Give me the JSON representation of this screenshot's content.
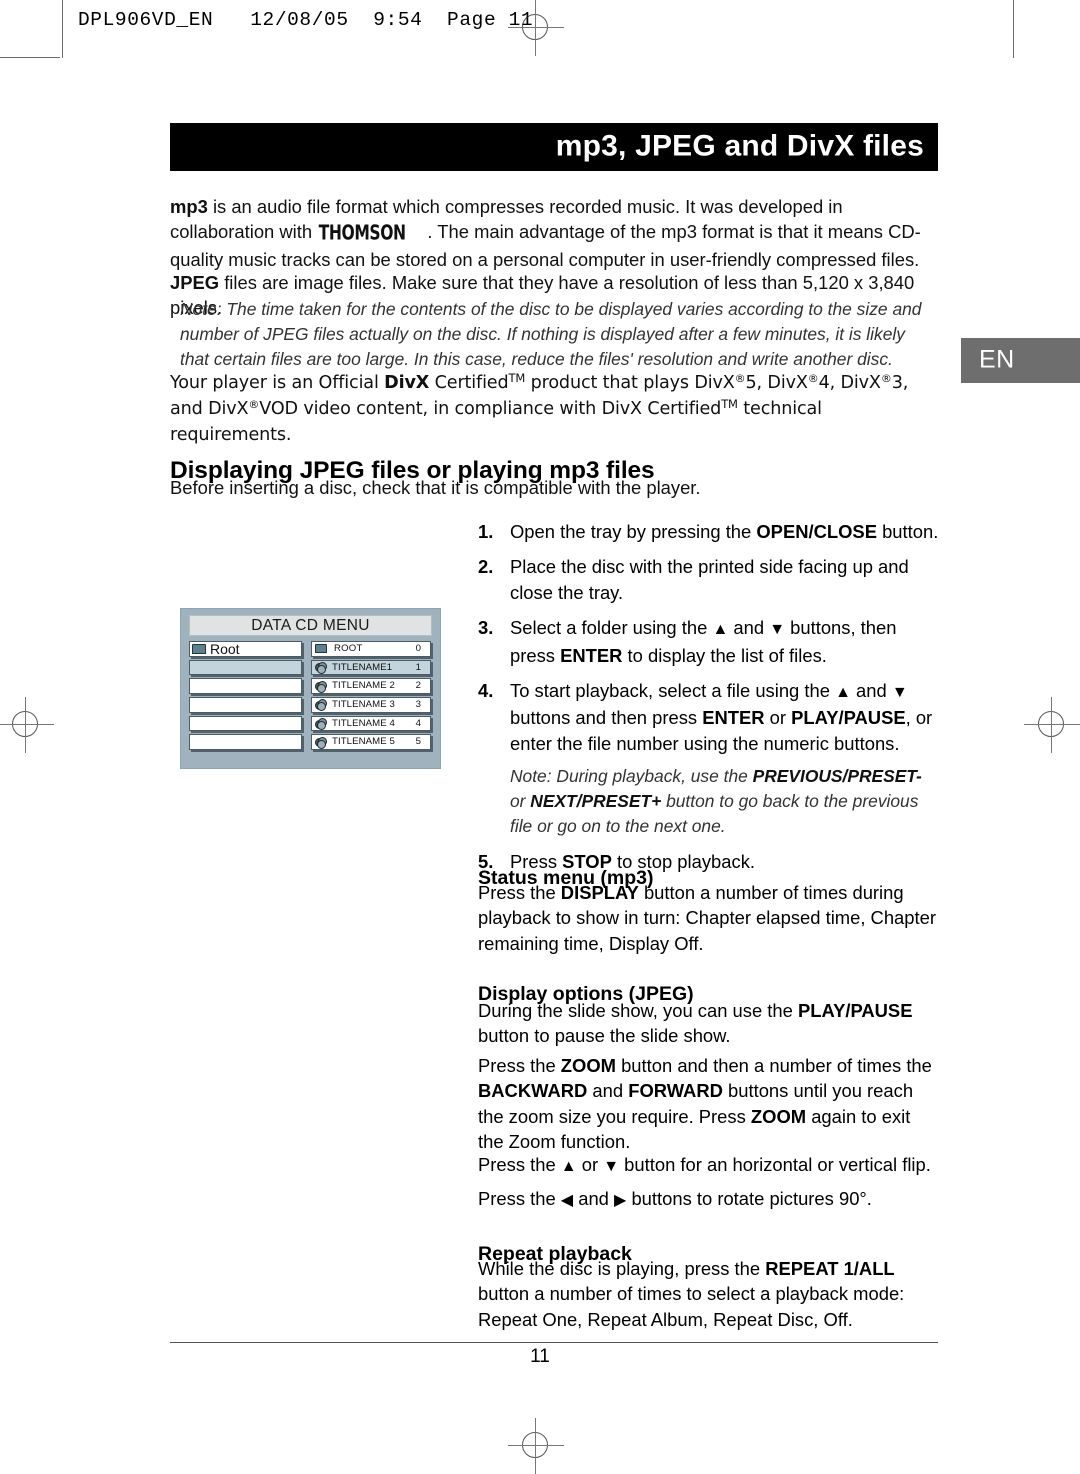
{
  "slug": "DPL906VD_EN   12/08/05  9:54  Page 11",
  "banner": {
    "title": "mp3, JPEG and DivX files"
  },
  "lang_tab": {
    "label": "EN"
  },
  "intro": {
    "mp3_lead": "mp3",
    "mp3_part1": " is an audio file format which compresses recorded music. It was developed in collaboration with ",
    "thomson_logo": "THOMSON",
    "mp3_part2": ". The main advantage of the mp3 format is that it means CD-quality music tracks can be stored on a personal computer in user-friendly compressed files.",
    "jpeg_lead": "JPEG",
    "jpeg_text": " files are image files. Make sure that they have a resolution of less than 5,120 x 3,840 pixels.",
    "note": "Note: The time taken for the contents of the disc to be displayed varies according to the size and number of JPEG files actually on the disc. If nothing is displayed after a few minutes, it is likely that certain files are too large. In this case, reduce the files' resolution and write another disc.",
    "divx_p1": "Your player is an Official ",
    "divx_bold": "DivX",
    "divx_p2": " Certified",
    "divx_tm": "TM",
    "divx_p3": " product that plays DivX",
    "divx_reg": "R",
    "divx_5": "5, DivX",
    "divx_4": "4, DivX",
    "divx_3": "3, and",
    "divx_line2_a": "DivX",
    "divx_line2_b": "VOD video content, in compliance with DivX Certified",
    "divx_line2_c": " technical requirements."
  },
  "section": {
    "heading": "Displaying JPEG files or playing mp3 files",
    "intro": "Before inserting a disc, check that it is compatible with the player."
  },
  "figure": {
    "title": "DATA CD MENU",
    "left_rows": [
      {
        "label": "Root",
        "icon": "folder-icon",
        "selected": false
      },
      {
        "label": "",
        "icon": "",
        "selected": true
      },
      {
        "label": "",
        "icon": "",
        "selected": false
      },
      {
        "label": "",
        "icon": "",
        "selected": false
      },
      {
        "label": "",
        "icon": "",
        "selected": false
      },
      {
        "label": "",
        "icon": "",
        "selected": false
      }
    ],
    "right_rows": [
      {
        "label": "ROOT",
        "num": "0",
        "icon": "folder-icon",
        "selected": false
      },
      {
        "label": "TITLENAME1",
        "num": "1",
        "icon": "media-icon",
        "selected": true
      },
      {
        "label": "TITLENAME 2",
        "num": "2",
        "icon": "media-icon",
        "selected": false
      },
      {
        "label": "TITLENAME 3",
        "num": "3",
        "icon": "media-icon",
        "selected": false
      },
      {
        "label": "TITLENAME 4",
        "num": "4",
        "icon": "media-icon",
        "selected": false
      },
      {
        "label": "TITLENAME 5",
        "num": "5",
        "icon": "media-icon",
        "selected": false
      }
    ]
  },
  "steps": [
    {
      "n": "1.",
      "parts": [
        {
          "t": "Open the tray by pressing the ",
          "b": false
        },
        {
          "t": "OPEN/CLOSE",
          "b": true
        },
        {
          "t": " button.",
          "b": false
        }
      ]
    },
    {
      "n": "2.",
      "parts": [
        {
          "t": "Place the disc with the printed side facing up and close the tray.",
          "b": false
        }
      ]
    },
    {
      "n": "3.",
      "parts": [
        {
          "t": "Select a folder using the ",
          "b": false
        },
        {
          "t": "▲",
          "b": false,
          "arrow": true
        },
        {
          "t": " and ",
          "b": false
        },
        {
          "t": "▼",
          "b": false,
          "arrow": true
        },
        {
          "t": " buttons, then press ",
          "b": false
        },
        {
          "t": "ENTER",
          "b": true
        },
        {
          "t": " to display the list of files.",
          "b": false
        }
      ]
    },
    {
      "n": "4.",
      "parts": [
        {
          "t": "To start playback, select a file using the ",
          "b": false
        },
        {
          "t": "▲",
          "b": false,
          "arrow": true
        },
        {
          "t": " and ",
          "b": false
        },
        {
          "t": "▼",
          "b": false,
          "arrow": true
        },
        {
          "t": " buttons and then press ",
          "b": false
        },
        {
          "t": "ENTER",
          "b": true
        },
        {
          "t": " or ",
          "b": false
        },
        {
          "t": "PLAY/PAUSE",
          "b": true
        },
        {
          "t": ", or enter the file number using the numeric buttons.",
          "b": false
        }
      ]
    },
    {
      "n": "5.",
      "parts": [
        {
          "t": "Press ",
          "b": false
        },
        {
          "t": "STOP",
          "b": true
        },
        {
          "t": " to stop playback.",
          "b": false
        }
      ]
    }
  ],
  "step4_note": {
    "a": "Note: During playback, use the ",
    "b1": "PREVIOUS/PRESET-",
    "c": " or ",
    "b2": "NEXT/PRESET+",
    "d": " button to go back to the previous file or go on to the next one."
  },
  "status_menu": {
    "heading": "Status menu (mp3)",
    "p_a": "Press the ",
    "p_b": "DISPLAY",
    "p_c": " button a number of times during playback to show in turn: Chapter elapsed time, Chapter remaining time, Display Off."
  },
  "display_options": {
    "heading": "Display options (JPEG)",
    "p1_a": "During the slide show, you can use the ",
    "p1_b": "PLAY/PAUSE",
    "p1_c": " button to pause the slide show.",
    "p2_a": "Press the ",
    "p2_b1": "ZOOM",
    "p2_c": " button and then a number of times the ",
    "p2_b2": "BACKWARD",
    "p2_d": " and ",
    "p2_b3": "FORWARD",
    "p2_e": " buttons until you reach the zoom size you require. Press ",
    "p2_b4": "ZOOM",
    "p2_f": " again to exit the Zoom function.",
    "flip_a": "Press the ",
    "flip_up": "▲",
    "flip_b": " or ",
    "flip_down": "▼",
    "flip_c": " button for an horizontal or vertical flip.",
    "rotate_a": "Press the ",
    "rotate_left": "◀",
    "rotate_b": " and ",
    "rotate_right": "▶",
    "rotate_c": " buttons to rotate pictures 90°."
  },
  "repeat_playback": {
    "heading": "Repeat playback",
    "p_a": "While the disc is playing, press the ",
    "p_b": "REPEAT 1/ALL",
    "p_c": " button a number of times to select a playback mode: Repeat One, Repeat Album, Repeat Disc, Off."
  },
  "footer": {
    "folio": "11"
  },
  "colors": {
    "banner_bg": "#000000",
    "lang_tab_bg": "#6e6e6e",
    "figure_bg": "#9fb2bd",
    "figure_title_bg": "#dfe3e4",
    "figure_row_selected": "#c3d4dd"
  }
}
